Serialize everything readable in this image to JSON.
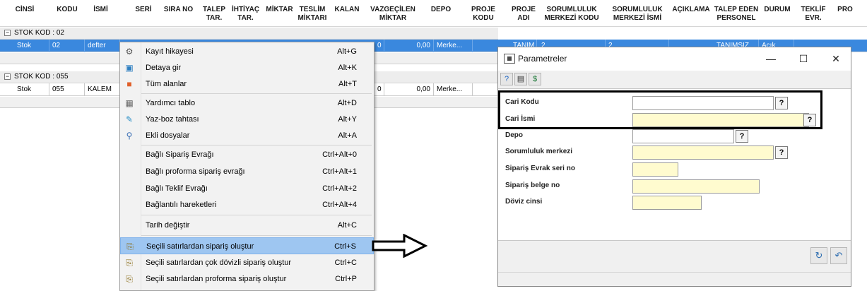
{
  "grid": {
    "columns": [
      "CİNSİ",
      "KODU",
      "İSMİ",
      "SERİ",
      "SIRA NO",
      "TALEP\nTAR.",
      "İHTİYAÇ\nTAR.",
      "MİKTAR",
      "TESLİM\nMİKTARI",
      "KALAN",
      "VAZGEÇİLEN\nMİKTAR",
      "DEPO",
      "PROJE\nKODU",
      "PROJE\nADI",
      "SORUMLULUK\nMERKEZİ KODU",
      "SORUMLULUK\nMERKEZİ İSMİ",
      "AÇIKLAMA",
      "TALEP EDEN\nPERSONEL",
      "DURUM",
      "TEKLİF\nEVR.",
      "PRO"
    ],
    "groups": [
      {
        "label": "STOK KOD : 02",
        "row": {
          "cinsi": "Stok",
          "kodu": "02",
          "ismi": "defter",
          "kalan_tail": "0",
          "vazgecilen": "0,00",
          "depo": "Merke...",
          "proje_adi": "TANIM...",
          "sorumluluk": "2",
          "sor_ismi": "2",
          "talep_eden": "TANIMSIZ",
          "durum": "Açık"
        }
      },
      {
        "label": "STOK KOD : 055",
        "row": {
          "cinsi": "Stok",
          "kodu": "055",
          "ismi": "KALEM",
          "kalan_tail": "0",
          "vazgecilen": "0,00",
          "depo": "Merke..."
        }
      }
    ]
  },
  "menu": {
    "items": [
      {
        "label": "Kayıt hikayesi",
        "shortcut": "Alt+G",
        "icon": "history-icon",
        "glyph": "⚙"
      },
      {
        "label": "Detaya gir",
        "shortcut": "Alt+K",
        "icon": "detail-icon",
        "glyph": "▣"
      },
      {
        "label": "Tüm alanlar",
        "shortcut": "Alt+T",
        "icon": "fields-icon",
        "glyph": "■"
      },
      {
        "label": "Yardımcı tablo",
        "shortcut": "Alt+D",
        "icon": "table-icon",
        "glyph": "▦"
      },
      {
        "label": "Yaz-boz tahtası",
        "shortcut": "Alt+Y",
        "icon": "notepad-icon",
        "glyph": "✎"
      },
      {
        "label": "Ekli dosyalar",
        "shortcut": "Alt+A",
        "icon": "paperclip-icon",
        "glyph": "⚲"
      },
      {
        "label": "Bağlı Sipariş Evrağı",
        "shortcut": "Ctrl+Alt+0",
        "icon": "",
        "glyph": ""
      },
      {
        "label": "Bağlı proforma sipariş evrağı",
        "shortcut": "Ctrl+Alt+1",
        "icon": "",
        "glyph": ""
      },
      {
        "label": "Bağlı Teklif Evrağı",
        "shortcut": "Ctrl+Alt+2",
        "icon": "",
        "glyph": ""
      },
      {
        "label": "Bağlantılı hareketleri",
        "shortcut": "Ctrl+Alt+4",
        "icon": "",
        "glyph": ""
      },
      {
        "label": "Tarih değiştir",
        "shortcut": "Alt+C",
        "icon": "",
        "glyph": ""
      },
      {
        "label": "Seçili satırlardan sipariş oluştur",
        "shortcut": "Ctrl+S",
        "icon": "order-icon",
        "glyph": "⎘"
      },
      {
        "label": "Seçili satırlardan çok dövizli sipariş oluştur",
        "shortcut": "Ctrl+C",
        "icon": "order-icon",
        "glyph": "⎘"
      },
      {
        "label": "Seçili satırlardan proforma sipariş oluştur",
        "shortcut": "Ctrl+P",
        "icon": "order-icon",
        "glyph": "⎘"
      }
    ]
  },
  "dialog": {
    "title": "Parametreler",
    "fields": [
      {
        "label": "Cari Kodu"
      },
      {
        "label": "Cari İsmi"
      },
      {
        "label": "Depo"
      },
      {
        "label": "Sorumluluk merkezi"
      },
      {
        "label": "Sipariş Evrak seri no"
      },
      {
        "label": "Sipariş belge no"
      },
      {
        "label": "Döviz cinsi"
      }
    ],
    "lookup_glyph": "?",
    "minimize": "—",
    "maximize": "☐",
    "close": "✕"
  },
  "colors": {
    "selected_row": "#3a88de",
    "menu_highlight": "#9ec6f1",
    "field_yellow": "#fffbcf"
  }
}
